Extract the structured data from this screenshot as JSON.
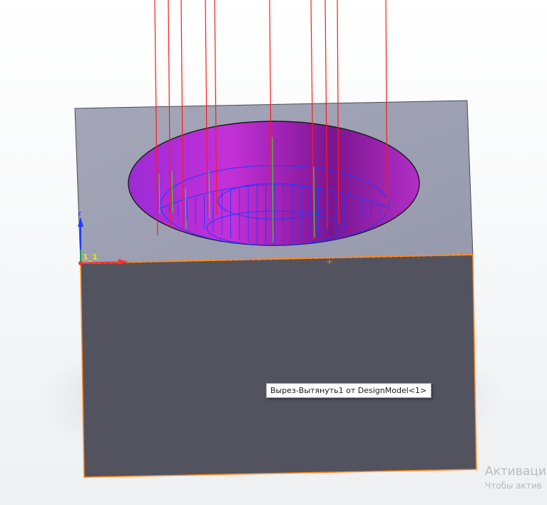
{
  "viewport": {
    "tooltip_text": "Вырез-Вытянуть1 от DesignModel<1>",
    "triad_label": "1_1",
    "triad_axis_label": "z"
  },
  "watermark": {
    "title": "Активаци",
    "subtitle": "Чтобы актив"
  },
  "colors": {
    "top_face": "#9ea0b2",
    "front_face": "#52535e",
    "pocket": "#8a15a0",
    "wire_blue": "#1f3cff",
    "leader_red": "#ff1a1a",
    "edge_orange": "#ff8a1e"
  }
}
